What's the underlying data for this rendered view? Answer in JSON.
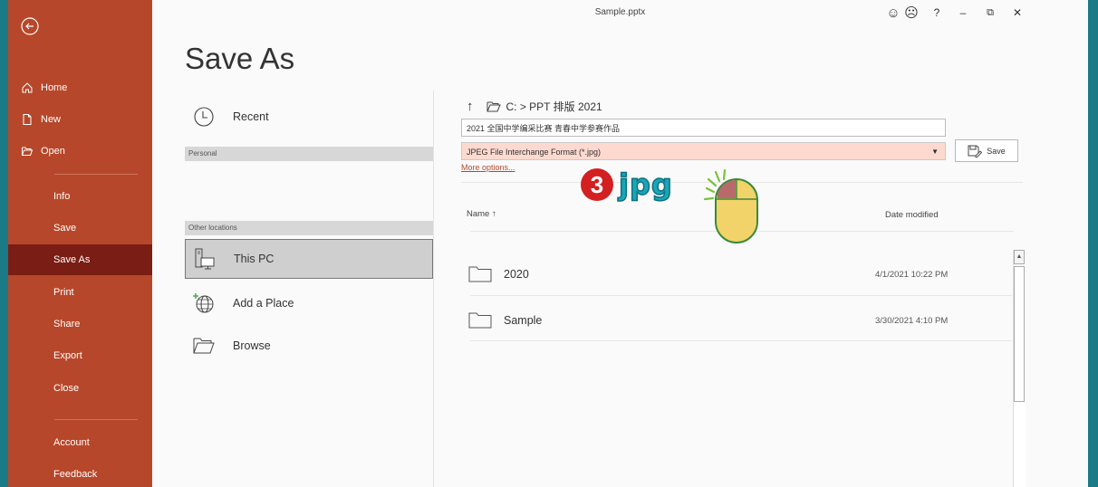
{
  "window": {
    "title": "Sample.pptx",
    "controls": {
      "smile": "☺",
      "frown": "☹",
      "help": "?",
      "minimize": "–",
      "restore": "⧉",
      "close": "✕"
    }
  },
  "nav": {
    "items": [
      {
        "label": "Home",
        "icon": "home-icon"
      },
      {
        "label": "New",
        "icon": "new-file-icon"
      },
      {
        "label": "Open",
        "icon": "open-folder-icon"
      },
      {
        "label": "Info"
      },
      {
        "label": "Save"
      },
      {
        "label": "Save As",
        "active": true
      },
      {
        "label": "Print"
      },
      {
        "label": "Share"
      },
      {
        "label": "Export"
      },
      {
        "label": "Close"
      },
      {
        "label": "Account"
      },
      {
        "label": "Feedback"
      }
    ]
  },
  "page": {
    "title": "Save As"
  },
  "locations": {
    "recent": "Recent",
    "personal_header": "Personal",
    "other_header": "Other locations",
    "this_pc": "This PC",
    "add_place": "Add a Place",
    "browse": "Browse"
  },
  "browser": {
    "path": "C: > PPT 排版 2021",
    "filename": "2021 全国中学编采比赛 青春中学参赛作品",
    "filetype": "JPEG File Interchange Format (*.jpg)",
    "save_label": "Save",
    "more_options": "More options...",
    "col_name": "Name ↑",
    "col_date": "Date modified",
    "files": [
      {
        "name": "2020",
        "date": "4/1/2021 10:22 PM"
      },
      {
        "name": "Sample",
        "date": "3/30/2021 4:10 PM"
      }
    ]
  },
  "annotation": {
    "step": "3",
    "text": "jpg"
  },
  "colors": {
    "nav_bg": "#b7472a",
    "nav_active": "#7a1d14",
    "accent_link": "#b7472a",
    "filetype_bg": "#fdd9cf",
    "outer_bg": "#1a7a85"
  }
}
